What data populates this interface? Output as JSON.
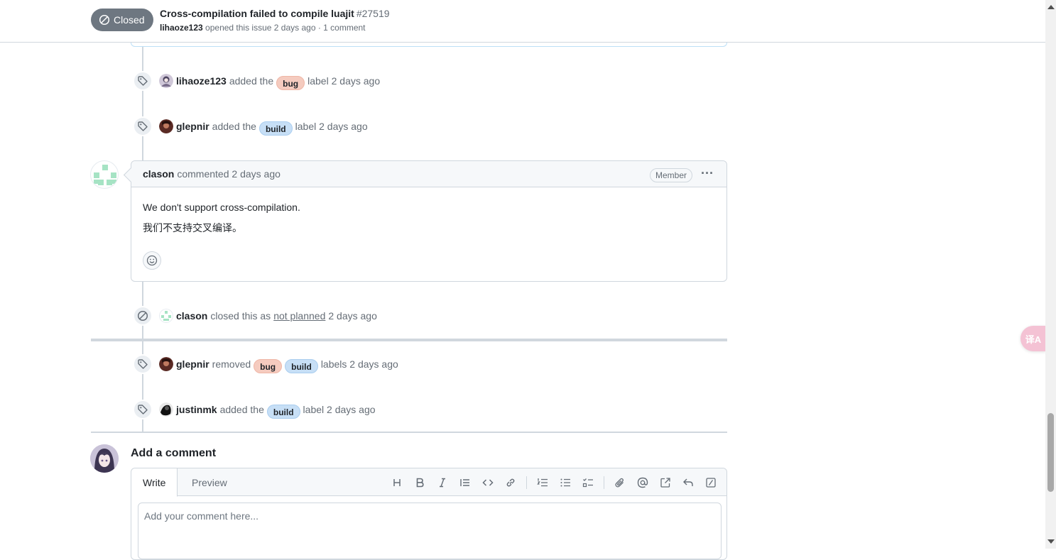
{
  "header": {
    "state": "Closed",
    "title": "Cross-compilation failed to compile luajit",
    "number": "#27519",
    "author": "lihaoze123",
    "meta_rest": "opened this issue 2 days ago · 1 comment"
  },
  "events": [
    {
      "actor": "lihaoze123",
      "pre": "added the",
      "labels": [
        "bug"
      ],
      "post": "label",
      "time": "2 days ago"
    },
    {
      "actor": "glepnir",
      "pre": "added the",
      "labels": [
        "build"
      ],
      "post": "label",
      "time": "2 days ago"
    }
  ],
  "comment": {
    "author": "clason",
    "action": "commented",
    "time": "2 days ago",
    "role": "Member",
    "more": "···",
    "body": [
      "We don't support cross-compilation.",
      "我们不支持交叉编译。"
    ]
  },
  "close_event": {
    "actor": "clason",
    "pre": "closed this as",
    "reason": "not planned",
    "time": "2 days ago"
  },
  "events_after": [
    {
      "actor": "glepnir",
      "pre": "removed",
      "labels": [
        "bug",
        "build"
      ],
      "post": "labels",
      "time": "2 days ago"
    },
    {
      "actor": "justinmk",
      "pre": "added the",
      "labels": [
        "build"
      ],
      "post": "label",
      "time": "2 days ago"
    }
  ],
  "add_comment": {
    "title": "Add a comment",
    "tab_write": "Write",
    "tab_preview": "Preview",
    "placeholder": "Add your comment here..."
  },
  "toolbar_icons": [
    "heading-icon",
    "bold-icon",
    "italic-icon",
    "quote-icon",
    "code-icon",
    "link-icon",
    "ordered-list-icon",
    "unordered-list-icon",
    "task-list-icon",
    "attach-icon",
    "mention-icon",
    "reference-icon",
    "reply-icon",
    "slash-command-icon"
  ],
  "labels_colors": {
    "bug": "#f5cbbf",
    "build": "#c7dff6"
  },
  "translate_button": "译A"
}
